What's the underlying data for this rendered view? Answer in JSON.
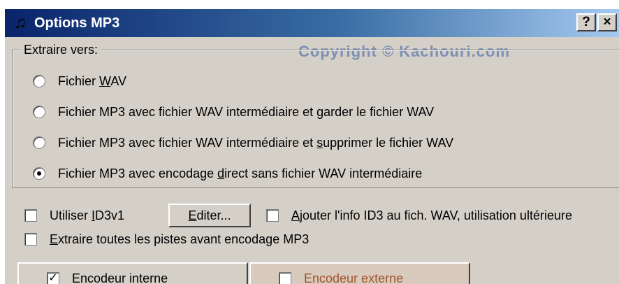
{
  "window": {
    "title": "Options MP3",
    "title_icon": "mp3-app-icon"
  },
  "titlebar_buttons": {
    "help": "?",
    "close": "×"
  },
  "watermark": "Copyright © Kachouri.com",
  "extract_group": {
    "legend": "Extraire vers:",
    "options": [
      {
        "pre": "Fichier ",
        "u": "W",
        "post": "AV",
        "checked": false
      },
      {
        "pre": "Fichier MP3 avec fichier WAV intermédiaire et ",
        "u": "g",
        "post": "arder le fichier WAV",
        "checked": false
      },
      {
        "pre": "Fichier MP3 avec fichier WAV intermédiaire et ",
        "u": "s",
        "post": "upprimer le fichier WAV",
        "checked": false
      },
      {
        "pre": "Fichier MP3 avec encodage ",
        "u": "d",
        "post": "irect sans fichier WAV intermédiaire",
        "checked": true
      }
    ]
  },
  "id3": {
    "pre": "Utiliser ",
    "u": "I",
    "post": "D3v1",
    "checked": false
  },
  "edit_button": {
    "u": "E",
    "post": "diter..."
  },
  "id3_wav": {
    "u": "A",
    "post": "jouter l'info ID3 au fich. WAV, utilisation ultérieure",
    "checked": false
  },
  "extract_all": {
    "u": "E",
    "post": "xtraire toutes les pistes avant encodage MP3",
    "checked": false
  },
  "tabs": [
    {
      "label": "Encodeur interne",
      "checked": true
    },
    {
      "label": "Encodeur externe",
      "checked": false
    }
  ]
}
